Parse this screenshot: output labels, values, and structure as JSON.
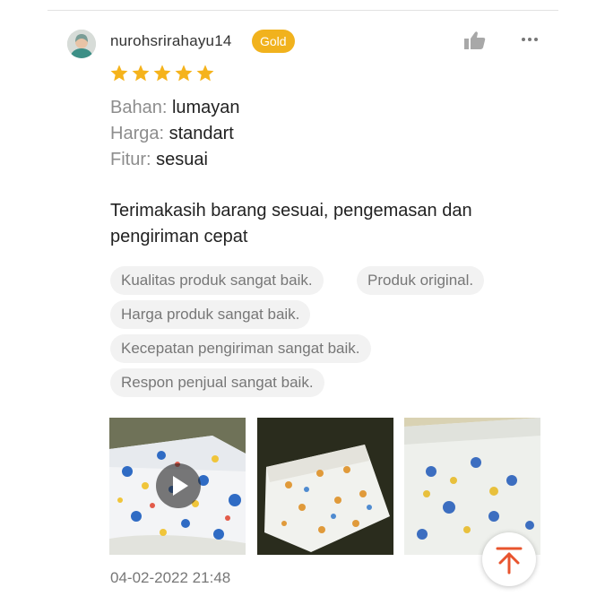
{
  "review": {
    "username": "nurohsrirahayu14",
    "badge": "Gold",
    "rating": 5,
    "attributes": [
      {
        "key": "Bahan:",
        "value": "lumayan"
      },
      {
        "key": "Harga:",
        "value": "standart"
      },
      {
        "key": "Fitur:",
        "value": "sesuai"
      }
    ],
    "text": "Terimakasih barang sesuai, pengemasan dan pengiriman cepat",
    "tags": [
      "Kualitas produk sangat baik.",
      "Produk original.",
      "Harga produk sangat baik.",
      "Kecepatan pengiriman sangat baik.",
      "Respon penjual sangat baik."
    ],
    "timestamp": "04-02-2022 21:48"
  },
  "colors": {
    "badge": "#f1b21d",
    "star": "#f5b31c",
    "back_to_top": "#e8542e"
  },
  "icons": {
    "like": "thumbs-up-icon",
    "more": "more-dots-icon",
    "play": "play-icon",
    "back_to_top": "arrow-up-to-top-icon",
    "star": "star-icon"
  }
}
